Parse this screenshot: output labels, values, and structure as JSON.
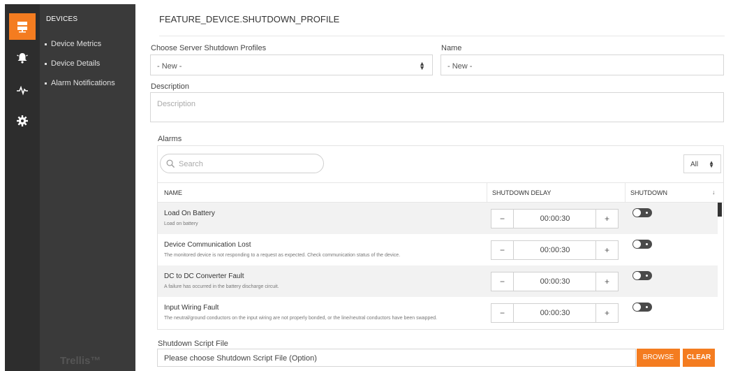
{
  "rail": {
    "items": [
      {
        "icon": "server-icon",
        "active": true
      },
      {
        "icon": "alarm-bell-icon",
        "active": false
      },
      {
        "icon": "pulse-icon",
        "active": false
      },
      {
        "icon": "gear-icon",
        "active": false
      }
    ],
    "active_color": "#f47c20"
  },
  "nav": {
    "title": "DEVICES",
    "items": [
      "Device Metrics",
      "Device Details",
      "Alarm Notifications"
    ],
    "brand": "Trellis™"
  },
  "page": {
    "title": "FEATURE_DEVICE.SHUTDOWN_PROFILE"
  },
  "form": {
    "profiles_label": "Choose Server Shutdown Profiles",
    "profiles_value": "- New -",
    "name_label": "Name",
    "name_value": "- New -",
    "description_label": "Description",
    "description_placeholder": "Description"
  },
  "alarms": {
    "label": "Alarms",
    "search_placeholder": "Search",
    "filter_value": "All",
    "columns": {
      "name": "NAME",
      "delay": "SHUTDOWN DELAY",
      "shutdown": "SHUTDOWN"
    },
    "rows": [
      {
        "name": "Load On Battery",
        "description": "Load on battery",
        "delay": "00:00:30"
      },
      {
        "name": "Device Communication Lost",
        "description": "The monitored device is not responding to a request as expected. Check communication status of the device.",
        "delay": "00:00:30"
      },
      {
        "name": "DC to DC Converter Fault",
        "description": "A failure has occurred in the battery discharge circuit.",
        "delay": "00:00:30"
      },
      {
        "name": "Input Wiring Fault",
        "description": "The neutral/ground conductors on the input wiring are not properly bonded, or the line/neutral conductors have been swapped.",
        "delay": "00:00:30"
      }
    ]
  },
  "script": {
    "label": "Shutdown Script File",
    "value": "Please choose Shutdown Script File (Option)",
    "browse_label": "BROWSE",
    "clear_label": "CLEAR"
  }
}
